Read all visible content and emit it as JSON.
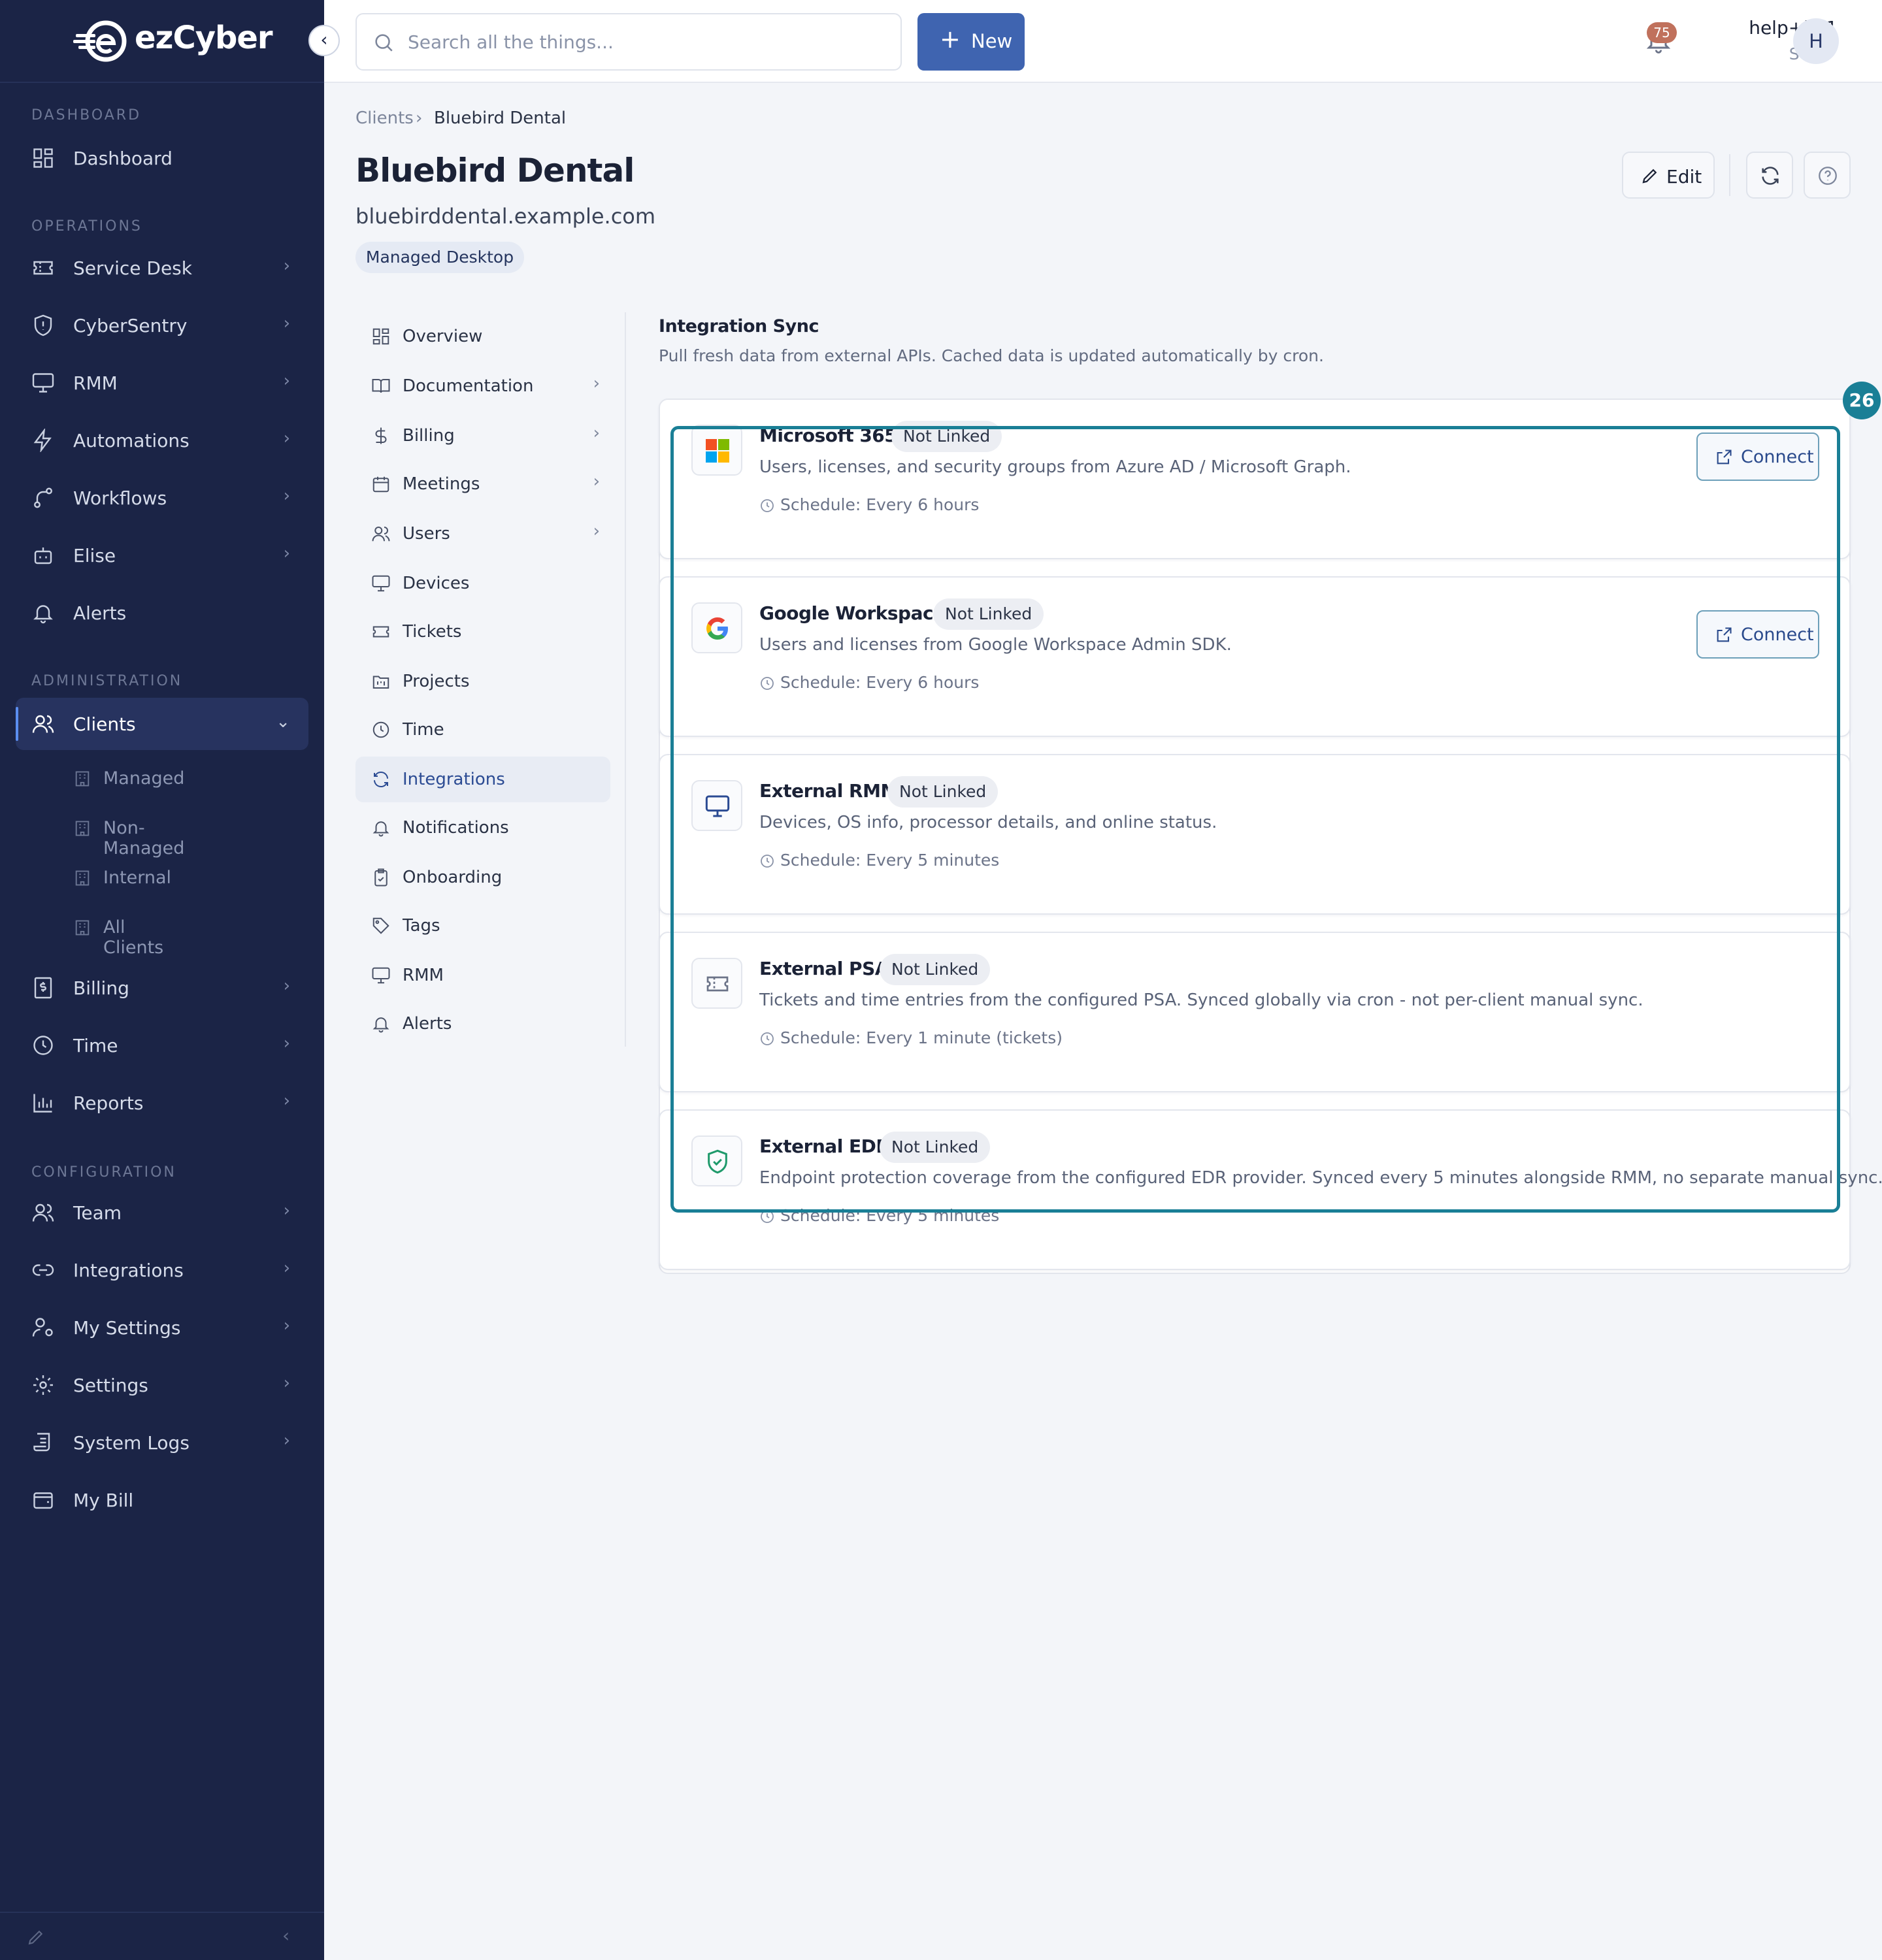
{
  "app": {
    "logo_text": "ezCyber"
  },
  "sidebar": {
    "sections": {
      "dashboard": "DASHBOARD",
      "operations": "OPERATIONS",
      "administration": "ADMINISTRATION",
      "configuration": "CONFIGURATION"
    },
    "items": {
      "dashboard": "Dashboard",
      "service_desk": "Service Desk",
      "cybersentry": "CyberSentry",
      "rmm": "RMM",
      "automations": "Automations",
      "workflows": "Workflows",
      "elise": "Elise",
      "alerts": "Alerts",
      "clients": "Clients",
      "billing": "Billing",
      "time": "Time",
      "reports": "Reports",
      "team": "Team",
      "integrations": "Integrations",
      "my_settings": "My Settings",
      "settings": "Settings",
      "system_logs": "System Logs",
      "my_bill": "My Bill"
    },
    "client_subitems": {
      "managed": "Managed",
      "non_managed": "Non-Managed",
      "internal": "Internal",
      "all_clients": "All Clients"
    }
  },
  "topbar": {
    "search_placeholder": "Search all the things...",
    "new_label": "New",
    "notification_count": "75",
    "user_name": "help+kb1",
    "user_role": "Staff",
    "avatar_initial": "H"
  },
  "breadcrumb": {
    "parent": "Clients",
    "current": "Bluebird Dental"
  },
  "client": {
    "name": "Bluebird Dental",
    "domain": "bluebirddental.example.com",
    "tag": "Managed Desktop",
    "edit_label": "Edit"
  },
  "subnav": {
    "overview": "Overview",
    "documentation": "Documentation",
    "billing": "Billing",
    "meetings": "Meetings",
    "users": "Users",
    "devices": "Devices",
    "tickets": "Tickets",
    "projects": "Projects",
    "time": "Time",
    "integrations": "Integrations",
    "notifications": "Notifications",
    "onboarding": "Onboarding",
    "tags": "Tags",
    "rmm": "RMM",
    "alerts": "Alerts"
  },
  "integration_sync": {
    "title": "Integration Sync",
    "description": "Pull fresh data from external APIs. Cached data is updated automatically by cron.",
    "highlight_badge": "26",
    "connect_label": "Connect",
    "cards": [
      {
        "name": "Microsoft 365",
        "status": "Not Linked",
        "description": "Users, licenses, and security groups from Azure AD / Microsoft Graph.",
        "schedule": "Schedule: Every 6 hours",
        "icon": "microsoft-icon"
      },
      {
        "name": "Google Workspace",
        "status": "Not Linked",
        "description": "Users and licenses from Google Workspace Admin SDK.",
        "schedule": "Schedule: Every 6 hours",
        "icon": "google-icon"
      },
      {
        "name": "External RMM",
        "status": "Not Linked",
        "description": "Devices, OS info, processor details, and online status.",
        "schedule": "Schedule: Every 5 minutes",
        "icon": "monitor-icon"
      },
      {
        "name": "External PSA",
        "status": "Not Linked",
        "description": "Tickets and time entries from the configured PSA. Synced globally via cron - not per-client manual sync.",
        "schedule": "Schedule: Every 1 minute (tickets)",
        "icon": "ticket-icon"
      },
      {
        "name": "External EDR",
        "status": "Not Linked",
        "description": "Endpoint protection coverage from the configured EDR provider. Synced every 5 minutes alongside RMM, no separate manual sync.",
        "schedule": "Schedule: Every 5 minutes",
        "icon": "shield-check-icon"
      }
    ]
  },
  "colors": {
    "sidebar_bg": "#1b2446",
    "primary": "#3f64b0",
    "highlight": "#1a7f96",
    "badge": "#c0715c"
  }
}
